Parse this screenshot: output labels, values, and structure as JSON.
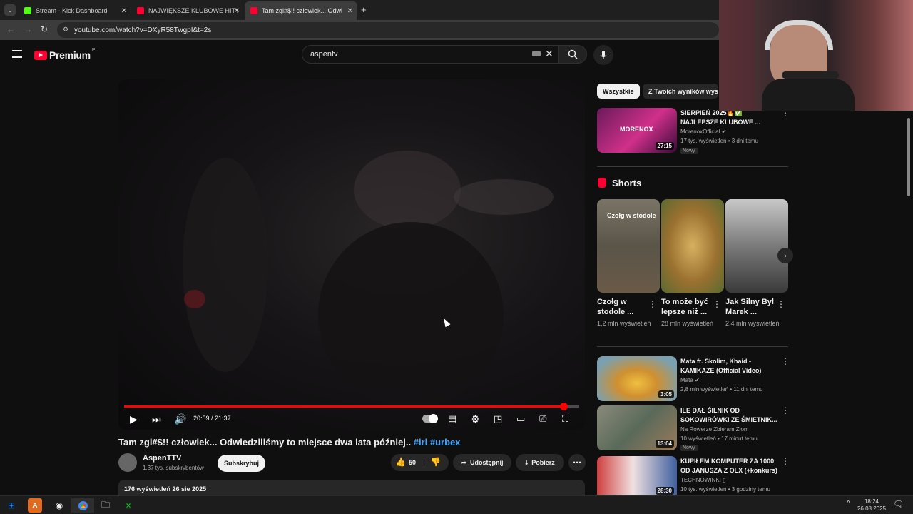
{
  "browser": {
    "tabs": [
      {
        "title": "Stream - Kick Dashboard",
        "favicon_color": "#53fc18"
      },
      {
        "title": "NAJWIĘKSZE KLUBOWE HITY ✅",
        "favicon_color": "#ff0033"
      },
      {
        "title": "Tam zgi#$!! człowiek... Odwiedz",
        "favicon_color": "#ff0033"
      }
    ],
    "new_tab_icon": "+",
    "url": "youtube.com/watch?v=DXyR58TwgpI&t=2s"
  },
  "header": {
    "brand": "Premium",
    "region": "PL",
    "search_value": "aspentv"
  },
  "player": {
    "time_current": "20:59",
    "time_total": "21:37",
    "progress": 0.965
  },
  "video": {
    "title": "Tam zgi#$!! człowiek... Odwiedziliśmy to miejsce dwa lata później..",
    "hashtags": "#irl #urbex",
    "channel": "AspenTTV",
    "subscribers": "1,37 tys. subskrybentów",
    "subscribe_label": "Subskrybuj",
    "likes": "50",
    "share_label": "Udostępnij",
    "download_label": "Pobierz",
    "views_date": "176 wyświetleń  26 sie 2025"
  },
  "filters": {
    "all": "Wszystkie",
    "yours": "Z Twoich wyników wysz"
  },
  "recommendations_top": [
    {
      "title": "SIERPIEŃ 2025🔥✅ NAJLEPSZE KLUBOWE ...",
      "channel": "MorenoxOfficial",
      "meta": "17 tys. wyświetleń • 3 dni temu",
      "duration": "27:15",
      "badge": "Nowy",
      "thumb_text": "MORENOX"
    }
  ],
  "shorts": {
    "heading": "Shorts",
    "items": [
      {
        "title": "Czołg w stodole ...",
        "views": "1,2 mln wyświetleń",
        "thumb_text": "Czołg w stodole"
      },
      {
        "title": "To może być lepsze niż ...",
        "views": "28 mln wyświetleń",
        "thumb_text": ""
      },
      {
        "title": "Jak Silny Był Marek ...",
        "views": "2,4 mln wyświetleń",
        "thumb_text": ""
      }
    ]
  },
  "recommendations": [
    {
      "title": "Mata ft. Skolim, Khaid - KAMIKAZE (Official Video)",
      "channel": "Mata",
      "meta": "2,8 mln wyświetleń • 11 dni temu",
      "duration": "3:05",
      "badge": ""
    },
    {
      "title": "ILE DAŁ ŚILNIK  OD SOKOWIRÓWKI ZE ŚMIETNIK...",
      "channel": "Na Rowerze Zbieram Złom",
      "meta": "10 wyświetleń • 17 minut temu",
      "duration": "13:04",
      "badge": "Nowy"
    },
    {
      "title": "KUPIŁEM KOMPUTER ZA 1000 OD JANUSZA Z OLX (+konkurs)",
      "channel": "TECHNOWINKI ▯",
      "meta": "10 tys. wyświetleń • 3 godziny temu",
      "duration": "28:30",
      "badge": ""
    }
  ],
  "taskbar": {
    "time": "18:24",
    "date": "26.08.2025"
  },
  "colors": {
    "accent": "#ff0033",
    "link": "#3ea6ff",
    "background": "#0f0f0f"
  }
}
